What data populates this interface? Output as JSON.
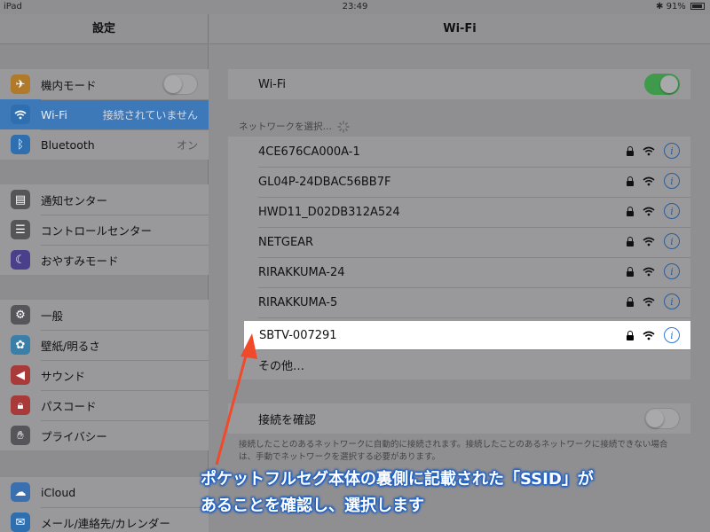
{
  "status_bar": {
    "device": "iPad",
    "time": "23:49",
    "bluetooth_icon": "bluetooth-icon",
    "battery_text": "91%",
    "battery_level": 0.91
  },
  "sidebar": {
    "title": "設定",
    "groups": [
      [
        {
          "label": "機内モード",
          "icon": "airplane-icon",
          "color": "#b07a2a",
          "toggle": "off"
        },
        {
          "label": "Wi-Fi",
          "icon": "wifi-icon",
          "color": "#2f6fb0",
          "value": "接続されていません",
          "selected": true
        },
        {
          "label": "Bluetooth",
          "icon": "bluetooth-icon",
          "color": "#2f6fb0",
          "value": "オン"
        }
      ],
      [
        {
          "label": "通知センター",
          "icon": "notification-icon",
          "color": "#555558"
        },
        {
          "label": "コントロールセンター",
          "icon": "control-center-icon",
          "color": "#555558"
        },
        {
          "label": "おやすみモード",
          "icon": "moon-icon",
          "color": "#4a3f8a"
        }
      ],
      [
        {
          "label": "一般",
          "icon": "gear-icon",
          "color": "#56565a"
        },
        {
          "label": "壁紙/明るさ",
          "icon": "wallpaper-icon",
          "color": "#3a7fa8"
        },
        {
          "label": "サウンド",
          "icon": "sound-icon",
          "color": "#a83a3a"
        },
        {
          "label": "パスコード",
          "icon": "lock-icon",
          "color": "#a83a3a"
        },
        {
          "label": "プライバシー",
          "icon": "hand-icon",
          "color": "#56565a"
        }
      ],
      [
        {
          "label": "iCloud",
          "icon": "cloud-icon",
          "color": "#3a6fb0"
        },
        {
          "label": "メール/連絡先/カレンダー",
          "icon": "mail-icon",
          "color": "#2f6fb0"
        }
      ]
    ]
  },
  "detail": {
    "title": "Wi-Fi",
    "wifi_label": "Wi-Fi",
    "wifi_toggle": "on",
    "networks_header": "ネットワークを選択…",
    "networks": [
      "4CE676CA000A-1",
      "GL04P-24DBAC56BB7F",
      "HWD11_D02DB312A524",
      "NETGEAR",
      "RIRAKKUMA-24",
      "RIRAKKUMA-5"
    ],
    "highlighted_network": "SBTV-007291",
    "other_label": "その他…",
    "info_glyph": "i",
    "ask_join_label": "接続を確認",
    "ask_join_toggle": "off",
    "ask_join_footnote": "接続したことのあるネットワークに自動的に接続されます。接続したことのあるネットワークに接続できない場合は、手動でネットワークを選択する必要があります。"
  },
  "annotation": {
    "line1": "ポケットフルセグ本体の裏側に記載された「SSID」が",
    "line2": "あることを確認し、選択します",
    "color": "#1c5fc6",
    "arrow_color": "#f04a2a"
  }
}
